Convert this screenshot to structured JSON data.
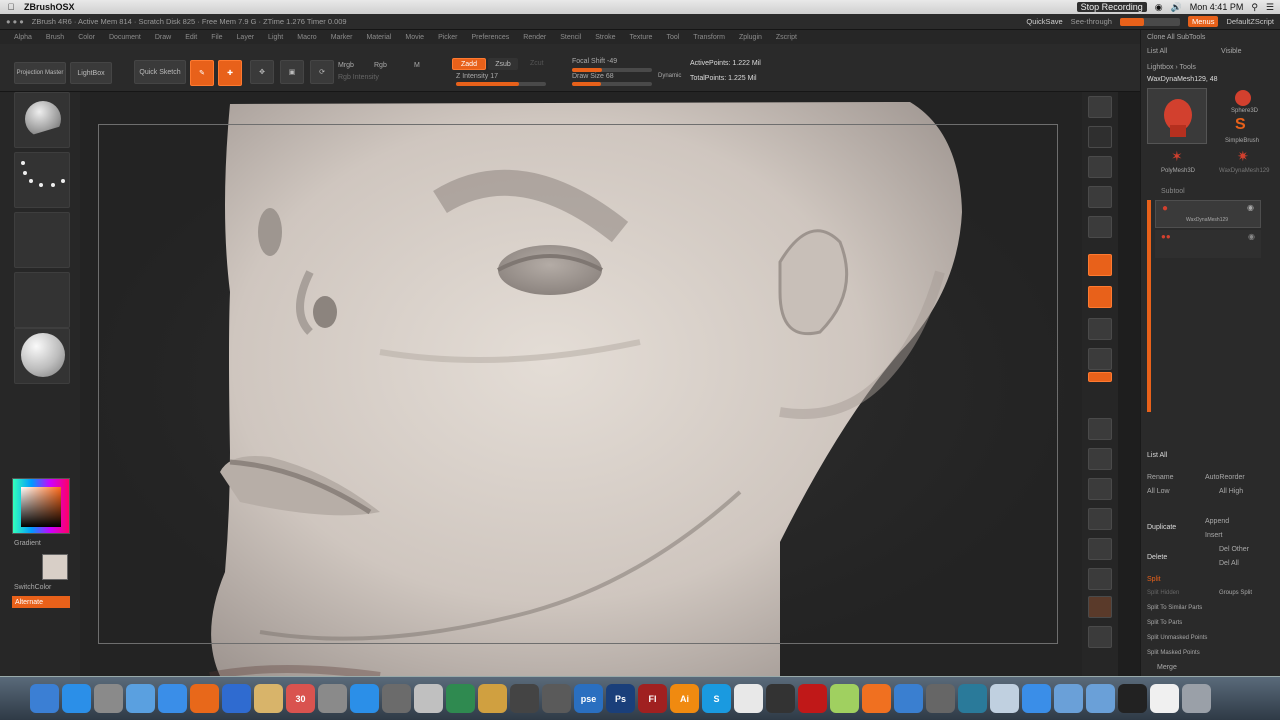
{
  "macbar": {
    "app_name": "ZBrushOSX",
    "stop_recording": "Stop Recording",
    "clock": "Mon 4:41 PM"
  },
  "title": {
    "text": "ZBrush 4R6   · Active Mem 814 · Scratch Disk 825 · Free Mem 7.9 G · ZTime 1.276 Timer 0.009",
    "quicksave": "QuickSave",
    "see_through": "See-through",
    "menus": "Menus",
    "default_zscript": "DefaultZScript"
  },
  "menu_items": [
    "Alpha",
    "Brush",
    "Color",
    "Document",
    "Draw",
    "Edit",
    "File",
    "Layer",
    "Light",
    "Macro",
    "Marker",
    "Material",
    "Movie",
    "Picker",
    "Preferences",
    "Render",
    "Stencil",
    "Stroke",
    "Texture",
    "Tool",
    "Transform",
    "Zplugin",
    "Zscript"
  ],
  "shelf": {
    "projection_master": "Projection Master",
    "lightbox": "LightBox",
    "quick_sketch": "Quick Sketch",
    "edit": "Edit",
    "draw": "Draw",
    "move": "Move",
    "scale": "Scale",
    "rotate": "Rotate",
    "mrgb": "Mrgb",
    "rgb": "Rgb",
    "m": "M",
    "zadd": "Zadd",
    "zsub": "Zsub",
    "zcut": "Zcut",
    "focal_shift": "Focal Shift -49",
    "draw_size": "Draw Size 68",
    "z_intensity": "Z Intensity 17",
    "dynamic": "Dynamic",
    "active_points": "ActivePoints: 1.222 Mil",
    "total_points": "TotalPoints: 1.225 Mil",
    "rgb_intensity": "Rgb Intensity"
  },
  "left": {
    "gradient": "Gradient",
    "switch_color": "SwitchColor",
    "alternate": "Alternate"
  },
  "right_palette": {
    "clone_all": "Clone All SubTools",
    "list_all": "List All",
    "visible": "Visible",
    "lightbox_tools": "Lightbox › Tools",
    "current_tool": "WaxDynaMesh129, 48",
    "tool_a": "Sphere3D",
    "tool_b": "SimpleBrush",
    "tool_c": "PolyMesh3D",
    "tool_d": "WaxDynaMesh129",
    "subtool_header": "Subtool",
    "subtool_1": "WaxDynaMesh129",
    "list_all_2": "List All",
    "rename": "Rename",
    "auto_reorder": "AutoReorder",
    "all_low": "All Low",
    "all_high": "All High",
    "duplicate": "Duplicate",
    "append": "Append",
    "insert": "Insert",
    "delete": "Delete",
    "del_other": "Del Other",
    "del_all": "Del All",
    "split": "Split",
    "split_hidden": "Split Hidden",
    "groups_split": "Groups Split",
    "split_similar": "Split To Similar Parts",
    "split_parts": "Split To Parts",
    "split_unmasked": "Split Unmasked Points",
    "split_masked": "Split Masked Points",
    "merge": "Merge"
  },
  "colors": {
    "accent": "#e8611a",
    "bg": "#2a2a2a",
    "model": "#d6cfc9"
  },
  "dock_icons": [
    "finder-icon",
    "appstore-icon",
    "system-prefs-icon",
    "preview-icon",
    "safari-icon",
    "firefox-icon",
    "quicktime-icon",
    "notes-icon",
    "calendar-icon",
    "tools-icon",
    "appstore2-icon",
    "flashpoint-icon",
    "photos-icon",
    "compass-icon",
    "guitar-icon",
    "chrome-alt-icon",
    "utility-icon",
    "pse-icon",
    "photoshop-icon",
    "flash-icon",
    "illustrator-icon",
    "skype-icon",
    "chrome-icon",
    "film-icon",
    "acrobat-icon",
    "ball-icon",
    "soundcloud-icon",
    "vpn-icon",
    "tools2-icon",
    "blender-icon",
    "cyberduck-icon",
    "browser-icon",
    "folder-icon",
    "folder2-icon",
    "music-icon",
    "textedit-icon",
    "trash-icon"
  ],
  "dock_labels": {
    "pse": "pse",
    "ps": "Ps",
    "fl": "Fl",
    "ai": "Ai",
    "skype": "S",
    "cal": "30"
  }
}
